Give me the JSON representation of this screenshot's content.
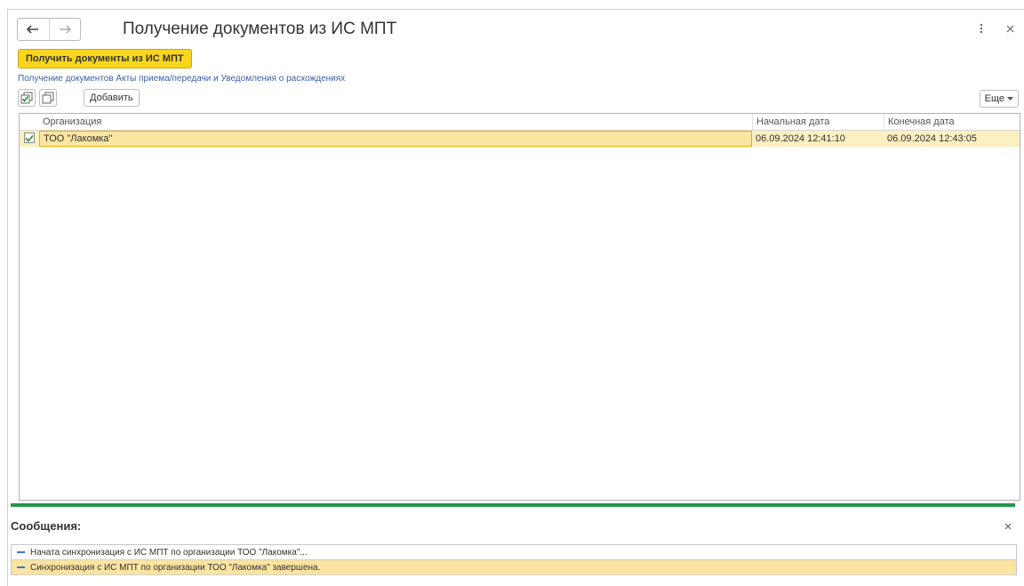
{
  "window": {
    "title": "Получение документов из ИС МПТ"
  },
  "actions": {
    "get_documents_label": "Получить документы из ИС МПТ",
    "info_link": "Получение документов Акты приема/передачи и Уведомления о расхождениях"
  },
  "toolbar": {
    "add_label": "Добавить",
    "more_label": "Еще"
  },
  "table": {
    "columns": {
      "org": "Организация",
      "start": "Начальная дата",
      "end": "Конечная дата"
    },
    "rows": [
      {
        "checked": true,
        "org": "ТОО \"Лакомка\"",
        "start": "06.09.2024 12:41:10",
        "end": "06.09.2024 12:43:05"
      }
    ]
  },
  "messages": {
    "title": "Сообщения:",
    "items": [
      {
        "text": "Начата синхронизация с ИС МПТ по организации ТОО \"Лакомка\"..."
      },
      {
        "text": "Синхронизация с ИС МПТ по организации ТОО \"Лакомка\" завершена."
      }
    ]
  },
  "colors": {
    "accent_yellow": "#f8d61d",
    "row_highlight": "#fcefc0",
    "green_divider": "#1f9a4a",
    "link_blue": "#3a5fa8"
  }
}
